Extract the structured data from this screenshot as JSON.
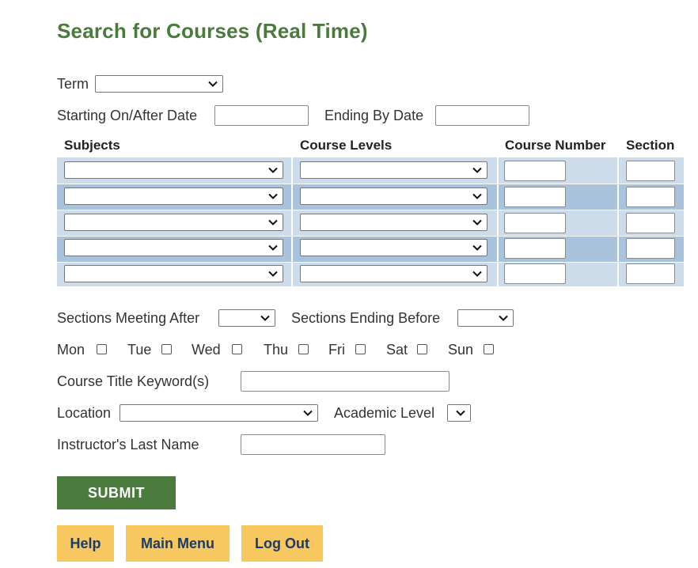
{
  "page_title": "Search for Courses (Real Time)",
  "term": {
    "label": "Term",
    "value": ""
  },
  "dates": {
    "start_label": "Starting On/After Date",
    "start_value": "",
    "end_label": "Ending By Date",
    "end_value": ""
  },
  "course_grid": {
    "headers": [
      "Subjects",
      "Course Levels",
      "Course Number",
      "Section"
    ],
    "rows": [
      {
        "subject": "",
        "course_level": "",
        "course_number": "",
        "section": ""
      },
      {
        "subject": "",
        "course_level": "",
        "course_number": "",
        "section": ""
      },
      {
        "subject": "",
        "course_level": "",
        "course_number": "",
        "section": ""
      },
      {
        "subject": "",
        "course_level": "",
        "course_number": "",
        "section": ""
      },
      {
        "subject": "",
        "course_level": "",
        "course_number": "",
        "section": ""
      }
    ],
    "colors": {
      "light_row": "#ccdcea",
      "dark_row": "#a9c3dd"
    }
  },
  "meeting": {
    "after_label": "Sections Meeting After",
    "after_value": "",
    "before_label": "Sections Ending Before",
    "before_value": ""
  },
  "days": [
    {
      "label": "Mon",
      "checked": false
    },
    {
      "label": "Tue",
      "checked": false
    },
    {
      "label": "Wed",
      "checked": false
    },
    {
      "label": "Thu",
      "checked": false
    },
    {
      "label": "Fri",
      "checked": false
    },
    {
      "label": "Sat",
      "checked": false
    },
    {
      "label": "Sun",
      "checked": false
    }
  ],
  "keyword": {
    "label": "Course Title Keyword(s)",
    "value": ""
  },
  "location": {
    "label": "Location",
    "value": ""
  },
  "academic_level": {
    "label": "Academic Level",
    "value": ""
  },
  "instructor": {
    "label": "Instructor's Last Name",
    "value": ""
  },
  "buttons": {
    "submit": "SUBMIT",
    "help": "Help",
    "main_menu": "Main Menu",
    "log_out": "Log Out"
  },
  "colors": {
    "title_green": "#4a7a3c",
    "submit_green": "#4a7a3c",
    "button_yellow": "#f6c85f",
    "button_text_navy": "#1d3a6b"
  },
  "icons": {
    "select_arrow": "chevron-down-icon"
  }
}
